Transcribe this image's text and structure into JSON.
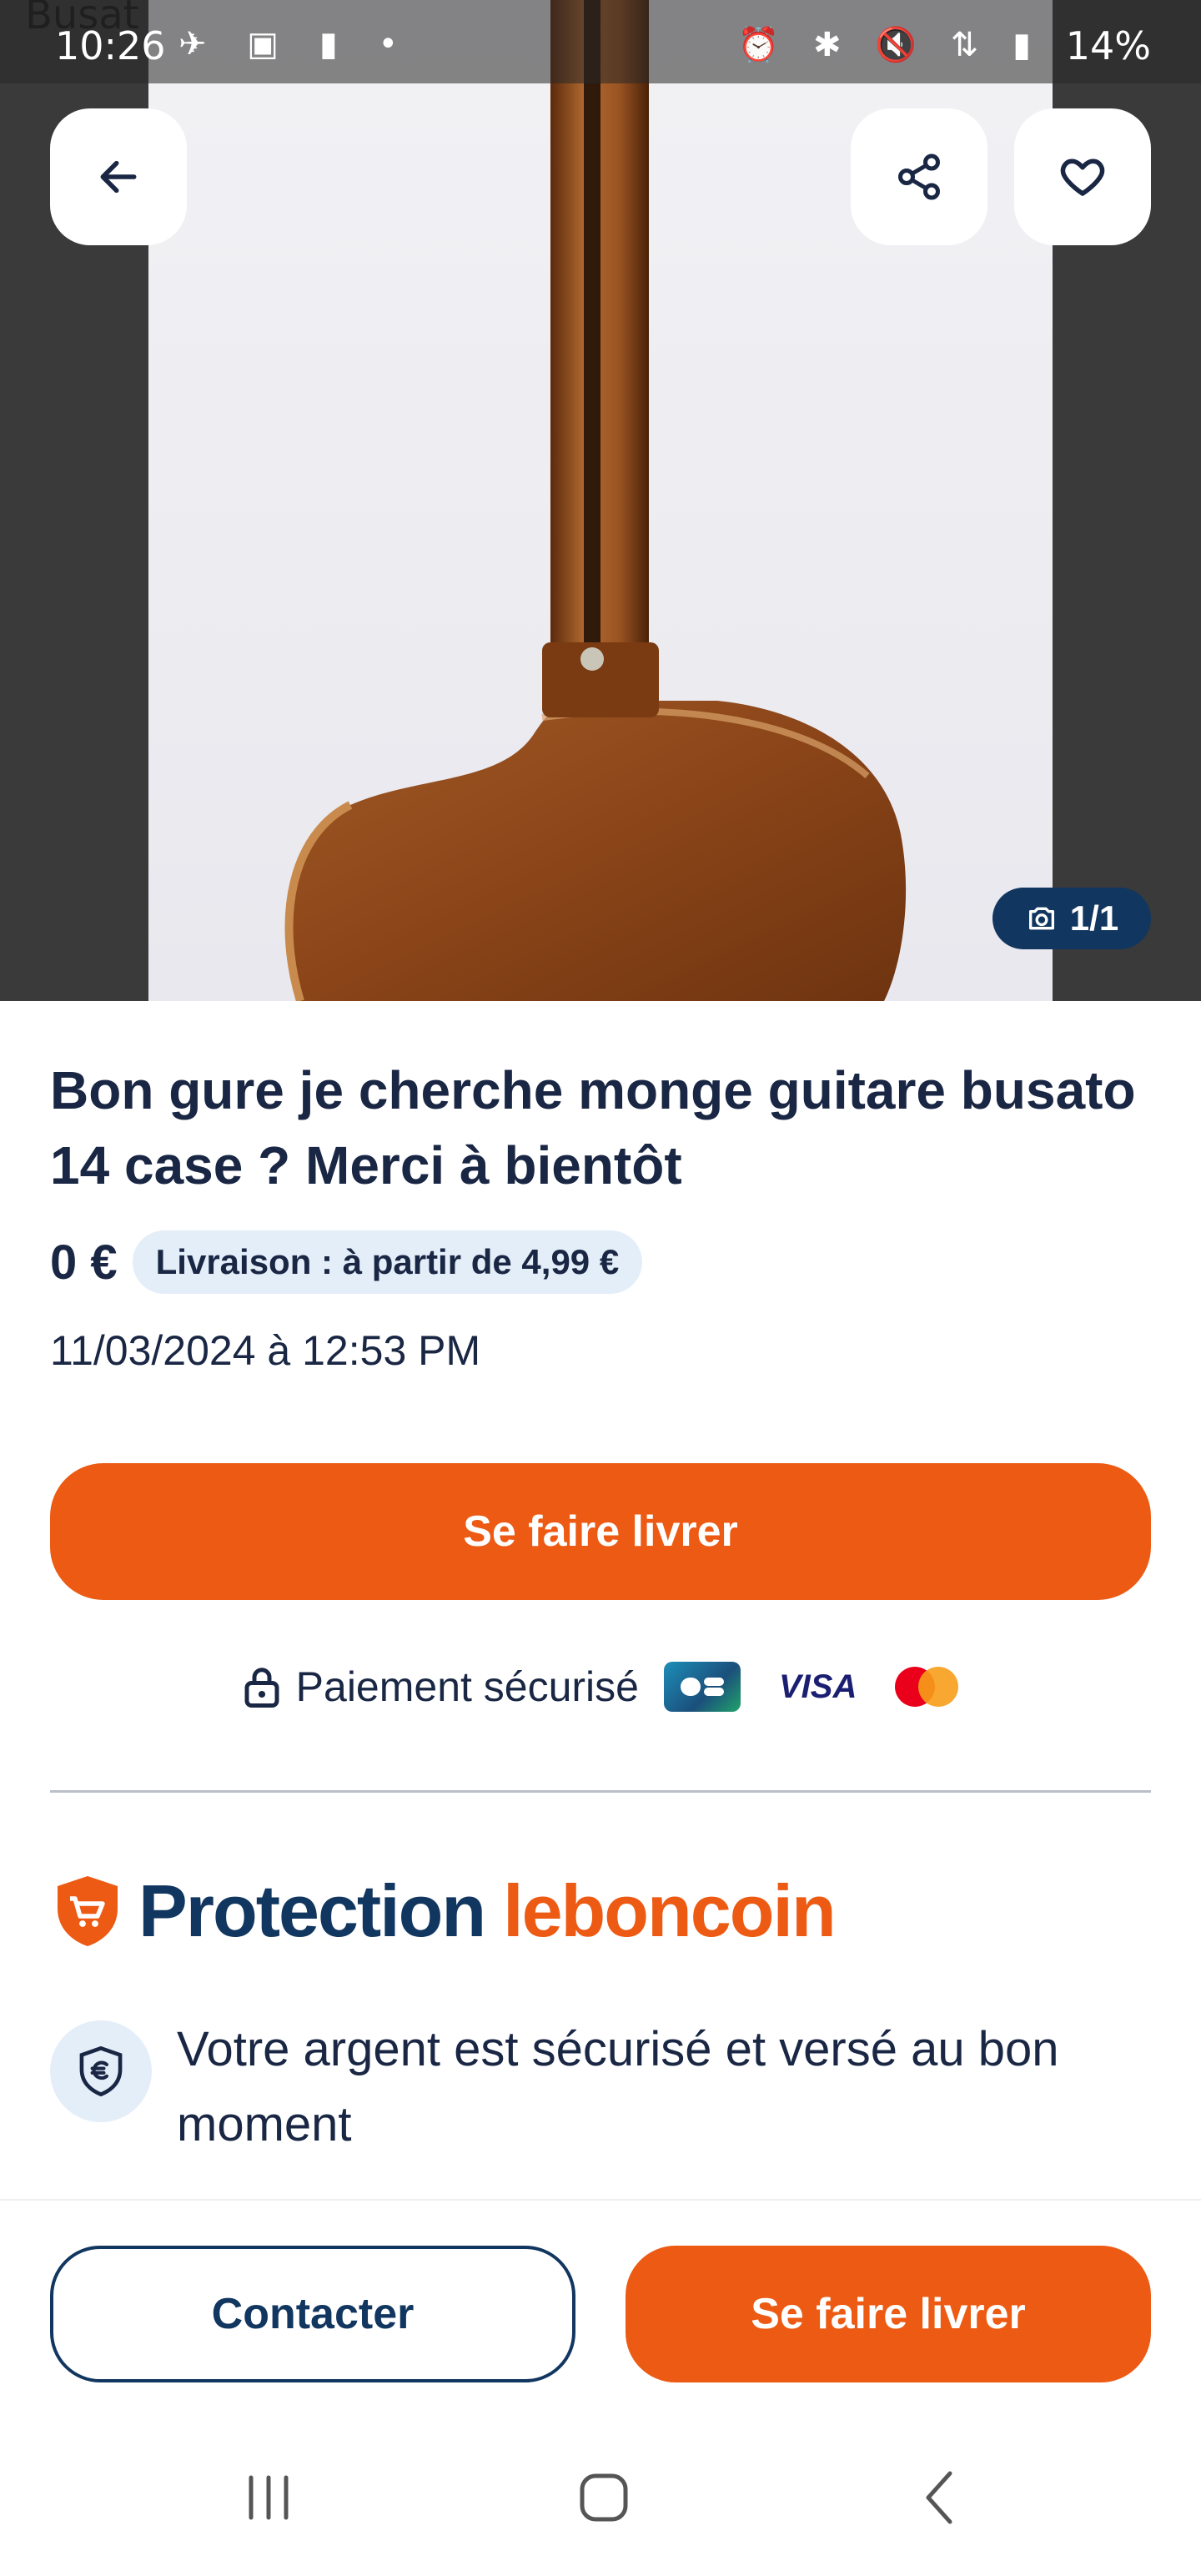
{
  "status_bar": {
    "time": "10:26",
    "battery": "14%",
    "overlay_text": "Busat"
  },
  "gallery": {
    "counter": "1/1"
  },
  "listing": {
    "title": "Bon gure je cherche monge guitare busato 14 case ? Merci à bientôt",
    "price": "0 €",
    "delivery_chip": "Livraison : à partir de 4,99 €",
    "date": "11/03/2024 à 12:53 PM"
  },
  "cta": {
    "deliver_label": "Se faire livrer"
  },
  "payment": {
    "secure_label": "Paiement sécurisé",
    "card_brands": [
      "CB",
      "VISA",
      "Mastercard"
    ],
    "visa_text": "VISA"
  },
  "protection": {
    "word1": "Protection",
    "word2": "leboncoin",
    "benefit_text": "Votre argent est sécurisé et versé au bon moment"
  },
  "bottom_actions": {
    "contact_label": "Contacter",
    "deliver_label": "Se faire livrer"
  },
  "colors": {
    "accent_orange": "#ec5a13",
    "navy": "#11365f",
    "chip_bg": "#e4eef9"
  }
}
